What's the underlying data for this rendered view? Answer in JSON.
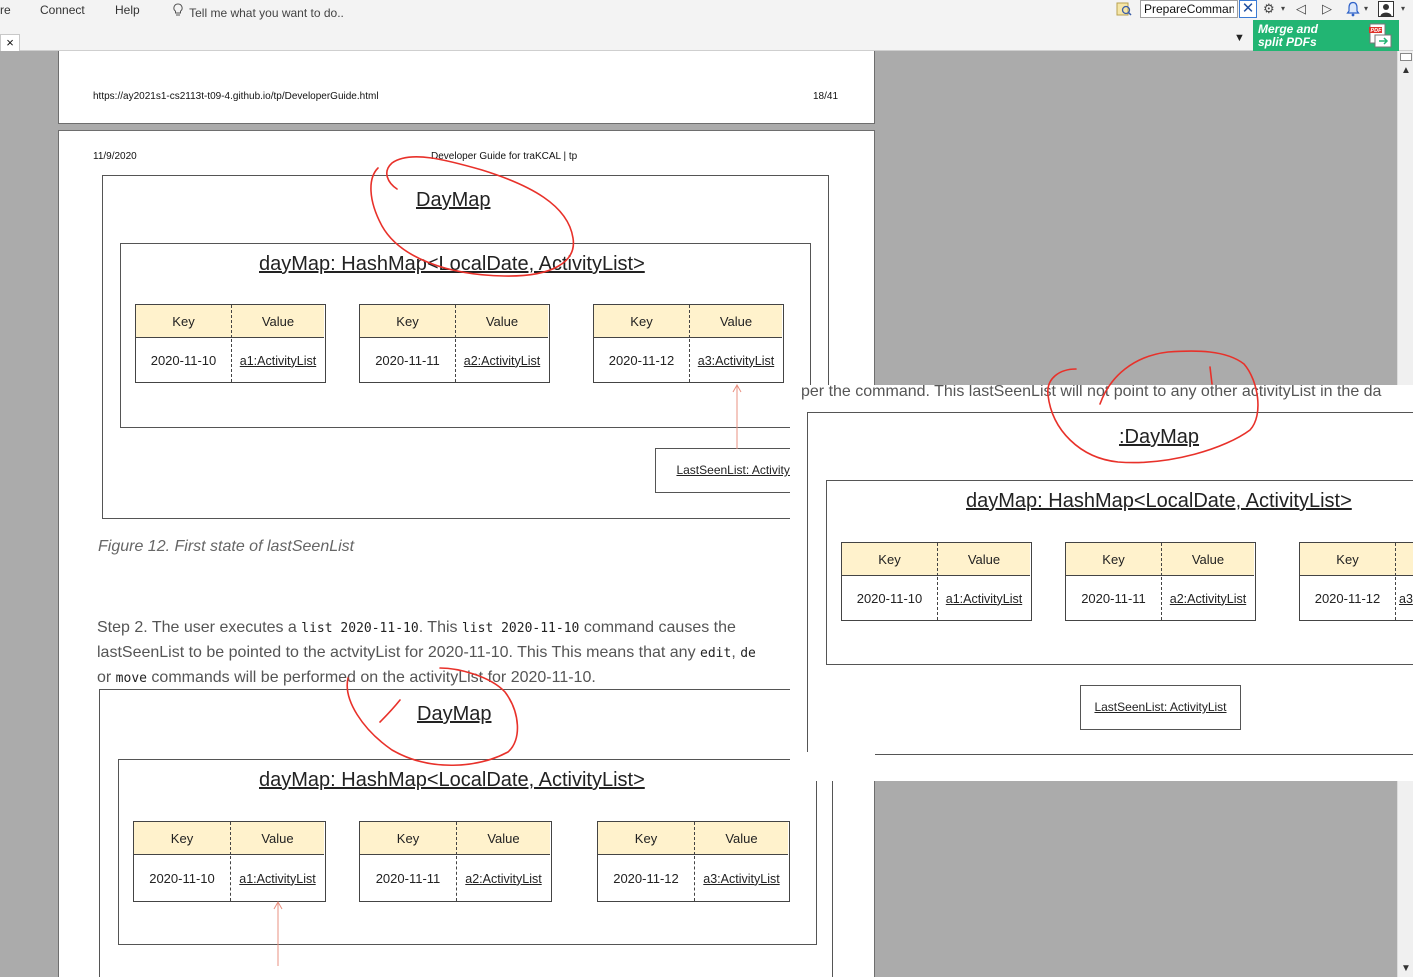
{
  "menubar": {
    "partial_item": "re",
    "items": [
      "Connect",
      "Help"
    ],
    "tell_me": "Tell me what you want to do.."
  },
  "toolbar": {
    "search_value": "PrepareComman",
    "close_glyph": "✕"
  },
  "tabbar": {
    "close_glyph": "×",
    "dropdown_glyph": "▼"
  },
  "promo": {
    "line1": "Merge and",
    "line2": "split PDFs",
    "icon_text": "PDF"
  },
  "page1": {
    "url": "https://ay2021s1-cs2113t-t09-4.github.io/tp/DeveloperGuide.html",
    "page_number": "18/41"
  },
  "page2": {
    "date": "11/9/2020",
    "title": "Developer Guide for traKCAL | tp",
    "diagram1": {
      "title": "DayMap",
      "hashmap_title": "dayMap: HashMap<LocalDate, ActivityList>",
      "entries": [
        {
          "key_header": "Key",
          "value_header": "Value",
          "key": "2020-11-10",
          "value": "a1:ActivityList"
        },
        {
          "key_header": "Key",
          "value_header": "Value",
          "key": "2020-11-11",
          "value": "a2:ActivityList"
        },
        {
          "key_header": "Key",
          "value_header": "Value",
          "key": "2020-11-12",
          "value": "a3:ActivityList"
        }
      ],
      "last_seen": "LastSeenList: ActivityList"
    },
    "caption": "Figure 12. First state of lastSeenList",
    "step2": {
      "line1_a": "Step 2. The user executes a ",
      "line1_code1": "list 2020-11-10",
      "line1_b": ". This ",
      "line1_code2": "list 2020-11-10",
      "line1_c": " command causes the",
      "line2_a": "lastSeenList to be pointed to the actvityList for 2020-11-10. This This means that any ",
      "line2_code1": "edit",
      "line2_b": ", ",
      "line2_code2": "de",
      "line3_a": "or ",
      "line3_code": "move",
      "line3_b": " commands will be performed on the activityList for 2020-11-10."
    },
    "diagram2": {
      "title": "DayMap",
      "hashmap_title": "dayMap: HashMap<LocalDate, ActivityList>",
      "entries": [
        {
          "key_header": "Key",
          "value_header": "Value",
          "key": "2020-11-10",
          "value": "a1:ActivityList"
        },
        {
          "key_header": "Key",
          "value_header": "Value",
          "key": "2020-11-11",
          "value": "a2:ActivityList"
        },
        {
          "key_header": "Key",
          "value_header": "Value",
          "key": "2020-11-12",
          "value": "a3:ActivityList"
        }
      ]
    }
  },
  "overlay": {
    "text_line": "per the command. This lastSeenList will not point to any other activityList in the da",
    "title": ":DayMap",
    "hashmap_title": "dayMap: HashMap<LocalDate, ActivityList>",
    "entries": [
      {
        "key_header": "Key",
        "value_header": "Value",
        "key": "2020-11-10",
        "value": "a1:ActivityList"
      },
      {
        "key_header": "Key",
        "value_header": "Value",
        "key": "2020-11-11",
        "value": "a2:ActivityList"
      },
      {
        "key_header": "Key",
        "key": "2020-11-12",
        "value": "a3"
      }
    ],
    "last_seen": "LastSeenList: ActivityList"
  },
  "colors": {
    "annotation_ink": "#e8312a",
    "kv_header": "#fff2cc",
    "promo": "#22b573",
    "background": "#ababab"
  }
}
